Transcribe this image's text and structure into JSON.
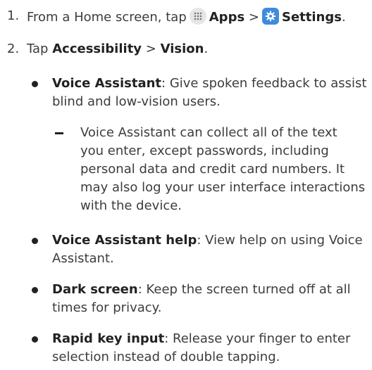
{
  "steps": [
    {
      "number": "1.",
      "text_pre": "From a Home screen, tap",
      "apps_label": "Apps",
      "separator": ">",
      "settings_label": "Settings",
      "end": ".",
      "apps_icon": "apps-grid-icon",
      "settings_icon": "gear-icon"
    },
    {
      "number": "2.",
      "text_pre": "Tap",
      "accessibility_label": "Accessibility",
      "separator": ">",
      "vision_label": "Vision",
      "end": "."
    }
  ],
  "items": [
    {
      "title": "Voice Assistant",
      "desc_line1": ": Give spoken feedback to assist",
      "desc_line2": "blind and low-vision users.",
      "note_lines": [
        "Voice Assistant can collect all of the text",
        "you enter, except passwords, including",
        "personal data and credit card numbers. It",
        "may also log your user interface interactions",
        "with the device."
      ]
    },
    {
      "title": "Voice Assistant help",
      "desc_line1": ": View help on using Voice",
      "desc_line2": "Assistant."
    },
    {
      "title": "Dark screen",
      "desc_line1": ": Keep the screen turned off at all",
      "desc_line2": "times for privacy."
    },
    {
      "title": "Rapid key input",
      "desc_line1": ": Release your finger to enter",
      "desc_line2": "selection instead of double tapping."
    }
  ],
  "colors": {
    "text": "#3c3c3c",
    "settings_icon_bg": "#3e8bdc",
    "apps_icon_bg": "#e6e6e6"
  }
}
